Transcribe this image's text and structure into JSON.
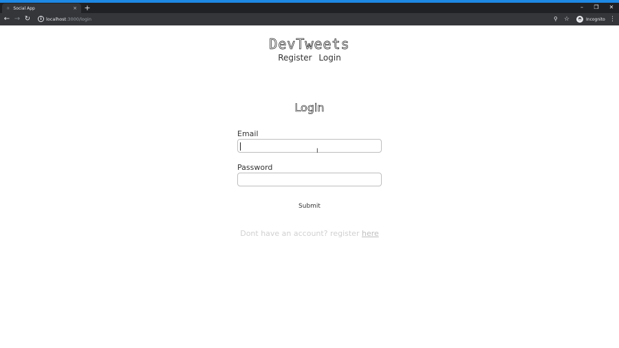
{
  "browser": {
    "tab_title": "Social App",
    "tab_close": "×",
    "new_tab": "+",
    "url_host": "localhost",
    "url_path": ":3000/login",
    "profile_label": "Incognito",
    "accent_color": "#1e88e5"
  },
  "icons": {
    "back": "←",
    "forward": "→",
    "reload": "↻",
    "info": "i",
    "zoom": "⚲",
    "star": "☆",
    "menu": "⋮",
    "minimize": "–",
    "maximize": "❐",
    "close": "✕",
    "favicon": "⚛",
    "incognito": "◓",
    "text_cursor": "I"
  },
  "site": {
    "brand": "DevTweets",
    "nav": {
      "register": "Register",
      "login": "Login"
    }
  },
  "login_form": {
    "heading": "Login",
    "email_label": "Email",
    "email_value": "",
    "password_label": "Password",
    "password_value": "",
    "submit_label": "Submit"
  },
  "footer": {
    "prompt": "Dont have an account? register ",
    "link": "here"
  }
}
